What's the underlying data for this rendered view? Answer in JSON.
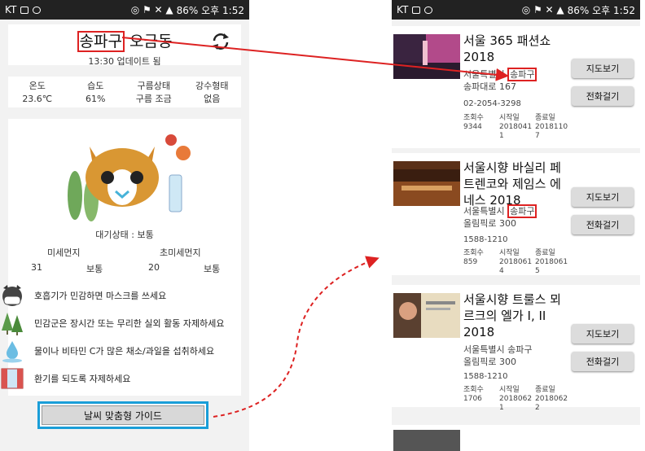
{
  "status": {
    "carrier": "KT",
    "right_text": "86% 오후 1:52"
  },
  "weather": {
    "district": "송파구",
    "dong": "오금동",
    "update": "13:30 업데이트 됨",
    "cols": [
      {
        "label": "온도",
        "value": "23.6℃"
      },
      {
        "label": "습도",
        "value": "61%"
      },
      {
        "label": "구름상태",
        "value": "구름 조금"
      },
      {
        "label": "강수형태",
        "value": "없음"
      }
    ],
    "air_state": "대기상태 : 보통",
    "pm10_label": "미세먼지",
    "pm25_label": "초미세먼지",
    "pm10_value": "31",
    "pm10_grade": "보통",
    "pm25_value": "20",
    "pm25_grade": "보통",
    "tips": [
      "호흡기가 민감하면 마스크를 쓰세요",
      "민감군은 장시간 또는 무리한 실외 활동 자제하세요",
      "물이나 비타민 C가 많은 채소/과일을 섭취하세요",
      "환기를 되도록 자제하세요"
    ],
    "guide_button": "날씨 맞춤형 가이드"
  },
  "events": [
    {
      "title": "서울 365 패션쇼 2018",
      "addr_prefix": "서울특별시 ",
      "addr_district": "송파구",
      "addr_rest": "송파대로 167",
      "phone": "02-2054-3298",
      "views_label": "조회수",
      "views": "9344",
      "start_label": "시작일",
      "start": "2018041 1",
      "end_label": "종료일",
      "end": "2018110 7",
      "map_btn": "지도보기",
      "call_btn": "전화걸기"
    },
    {
      "title": "서울시향 바실리 페트렌코와 제임스 에네스 2018",
      "addr_prefix": "서울특별시 ",
      "addr_district": "송파구",
      "addr_rest": "올림픽로 300",
      "phone": "1588-1210",
      "views_label": "조회수",
      "views": "859",
      "start_label": "시작일",
      "start": "2018061 4",
      "end_label": "종료일",
      "end": "2018061 5",
      "map_btn": "지도보기",
      "call_btn": "전화걸기"
    },
    {
      "title": "서울시향 트룰스 뫼르크의 엘가 I, II 2018",
      "addr_prefix": "서울특별시 ",
      "addr_district": "송파구",
      "addr_rest": "올림픽로 300",
      "phone": "1588-1210",
      "views_label": "조회수",
      "views": "1706",
      "start_label": "시작일",
      "start": "2018062 1",
      "end_label": "종료일",
      "end": "2018062 2",
      "map_btn": "지도보기",
      "call_btn": "전화걸기"
    }
  ],
  "colors": {
    "highlight": "#dd2222",
    "guide_border": "#1a9ed8",
    "arrow": "#dd2222"
  }
}
